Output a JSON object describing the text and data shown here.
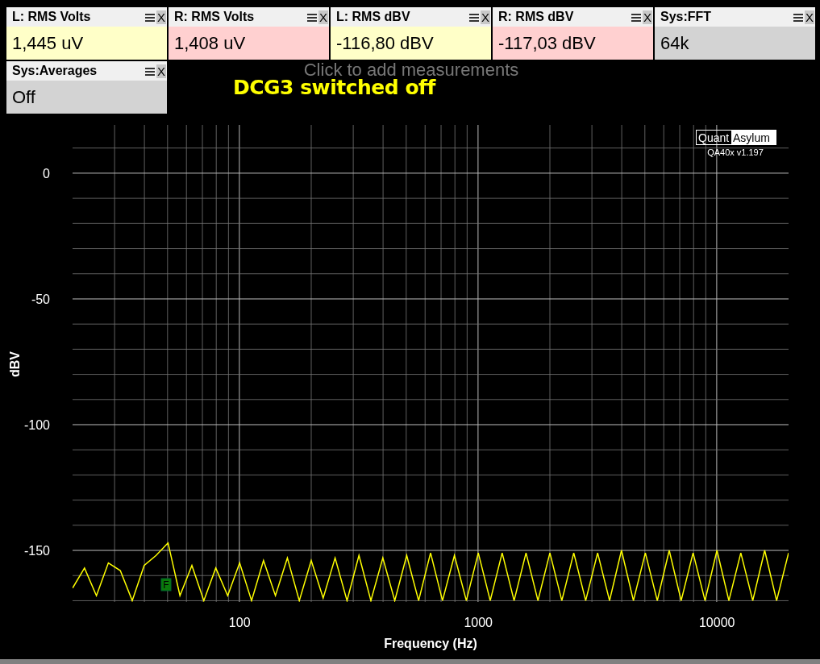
{
  "measurements": [
    {
      "title": "L: RMS Volts",
      "value": "1,445 uV",
      "color": "#ffffc8",
      "close": "X"
    },
    {
      "title": "R: RMS Volts",
      "value": "1,408 uV",
      "color": "#ffd0d0",
      "close": "X"
    },
    {
      "title": "L: RMS dBV",
      "value": "-116,80 dBV",
      "color": "#ffffc8",
      "close": "X"
    },
    {
      "title": "R: RMS dBV",
      "value": "-117,03 dBV",
      "color": "#ffd0d0",
      "close": "X"
    },
    {
      "title": "Sys:FFT",
      "value": "64k",
      "color": "#d3d3d3",
      "close": "X"
    },
    {
      "title": "Sys:Averages",
      "value": "Off",
      "color": "#d3d3d3",
      "close": "X"
    }
  ],
  "add_hint": "Click to add measurements",
  "caption": "DCG3 switched off",
  "logo": {
    "left": "Quant",
    "right": "Asylum",
    "version": "QA40x v1.197"
  },
  "chart": {
    "chart_data": {
      "type": "line",
      "grid": true,
      "xlabel": "Frequency (Hz)",
      "ylabel": "dBV",
      "ylim": [
        -170.5,
        19.2
      ],
      "yticks": [
        0,
        -50,
        -100,
        -150
      ],
      "categories": [
        null,
        null,
        null,
        null,
        null,
        null,
        null,
        null,
        null,
        null,
        null,
        null,
        null,
        null,
        "100",
        null,
        null,
        null,
        null,
        null,
        null,
        null,
        null,
        null,
        null,
        null,
        null,
        null,
        null,
        null,
        null,
        null,
        null,
        null,
        "1000",
        null,
        null,
        null,
        null,
        null,
        null,
        null,
        null,
        null,
        null,
        null,
        null,
        null,
        null,
        null,
        null,
        null,
        null,
        null,
        "10000",
        null,
        null,
        null,
        null,
        null,
        null
      ],
      "series": [
        {
          "color": "#ffff00",
          "values": [
            -165,
            -157,
            -168,
            -155,
            -158,
            -170,
            -156,
            -152,
            -147,
            -168,
            -156,
            -170,
            -157,
            -168,
            -155,
            -170,
            -154,
            -168,
            -153,
            -170,
            -154,
            -169,
            -153,
            -170,
            -152,
            -170,
            -153,
            -170,
            -152,
            -170,
            -151,
            -170,
            -152,
            -170,
            -151,
            -170,
            -151,
            -170,
            -151,
            -170,
            -151,
            -170,
            -151,
            -170,
            -151,
            -170,
            -150,
            -170,
            -151,
            -170,
            -150,
            -170,
            -151,
            -170,
            -150,
            -170,
            -151,
            -170,
            -150,
            -170,
            -151
          ]
        }
      ],
      "annotations": [
        "F"
      ]
    }
  }
}
